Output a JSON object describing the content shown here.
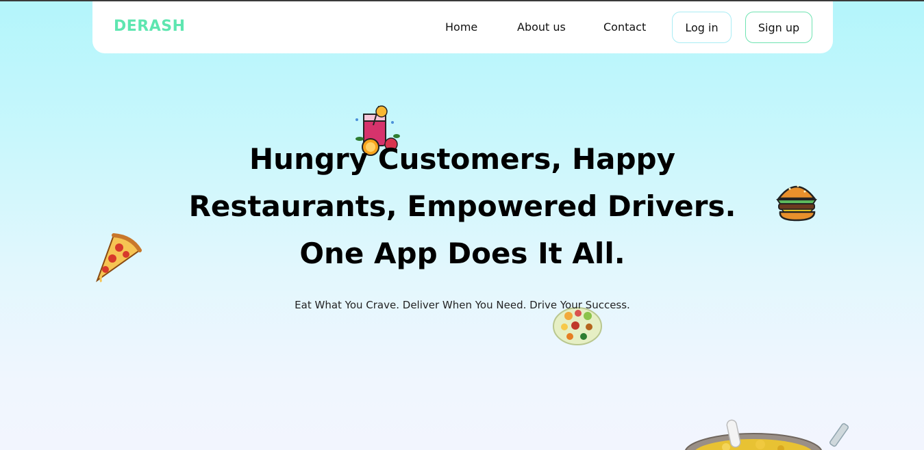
{
  "navbar": {
    "logo": "DERASH",
    "links": [
      "Home",
      "About us",
      "Contact"
    ],
    "login_label": "Log in",
    "signup_label": "Sign up"
  },
  "hero": {
    "title_lines": [
      "Hungry Customers, Happy",
      "Restaurants, Empowered Drivers.",
      "One App Does It All."
    ],
    "subtitle": "Eat What You Crave. Deliver When You Need. Drive Your Success."
  },
  "decorations": [
    "drink-icon",
    "burger-icon",
    "pizza-icon",
    "food-plate-icon",
    "food-bowl-image"
  ],
  "colors": {
    "brand": "#5ee6b0",
    "login_border": "#a9ecf4",
    "signup_border": "#6ee3b1",
    "bg_top": "#b3f5fb",
    "bg_bottom": "#f2f5fe"
  }
}
